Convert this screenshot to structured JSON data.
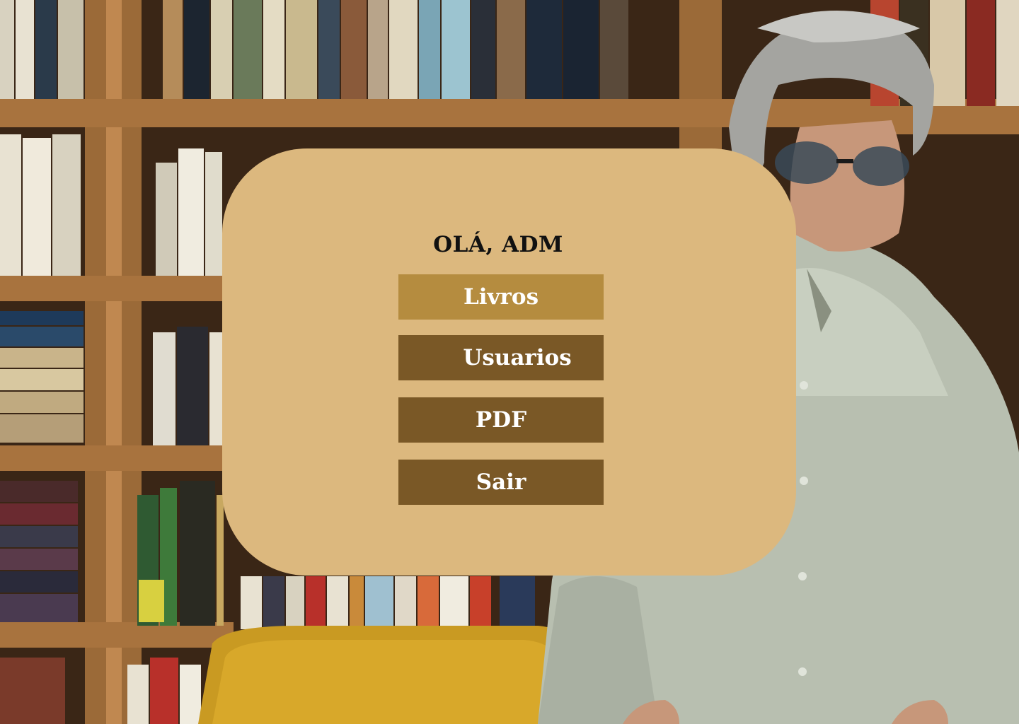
{
  "header": {
    "greeting": "OLÁ, ADM"
  },
  "menu": {
    "items": [
      {
        "label": "Livros"
      },
      {
        "label": "Usuarios"
      },
      {
        "label": "PDF"
      },
      {
        "label": "Sair"
      }
    ]
  },
  "colors": {
    "panel": "#dcb87e",
    "button_active": "#b58c3f",
    "button": "#7a5826",
    "button_text": "#ffffff",
    "greeting_text": "#111111"
  }
}
